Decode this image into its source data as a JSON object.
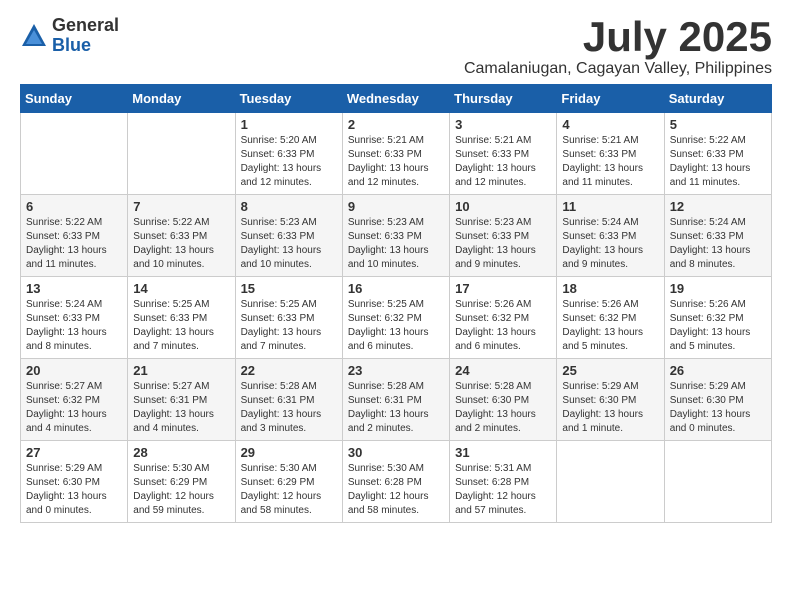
{
  "header": {
    "logo_general": "General",
    "logo_blue": "Blue",
    "month": "July 2025",
    "location": "Camalaniugan, Cagayan Valley, Philippines"
  },
  "weekdays": [
    "Sunday",
    "Monday",
    "Tuesday",
    "Wednesday",
    "Thursday",
    "Friday",
    "Saturday"
  ],
  "weeks": [
    [
      {
        "day": "",
        "detail": ""
      },
      {
        "day": "",
        "detail": ""
      },
      {
        "day": "1",
        "detail": "Sunrise: 5:20 AM\nSunset: 6:33 PM\nDaylight: 13 hours\nand 12 minutes."
      },
      {
        "day": "2",
        "detail": "Sunrise: 5:21 AM\nSunset: 6:33 PM\nDaylight: 13 hours\nand 12 minutes."
      },
      {
        "day": "3",
        "detail": "Sunrise: 5:21 AM\nSunset: 6:33 PM\nDaylight: 13 hours\nand 12 minutes."
      },
      {
        "day": "4",
        "detail": "Sunrise: 5:21 AM\nSunset: 6:33 PM\nDaylight: 13 hours\nand 11 minutes."
      },
      {
        "day": "5",
        "detail": "Sunrise: 5:22 AM\nSunset: 6:33 PM\nDaylight: 13 hours\nand 11 minutes."
      }
    ],
    [
      {
        "day": "6",
        "detail": "Sunrise: 5:22 AM\nSunset: 6:33 PM\nDaylight: 13 hours\nand 11 minutes."
      },
      {
        "day": "7",
        "detail": "Sunrise: 5:22 AM\nSunset: 6:33 PM\nDaylight: 13 hours\nand 10 minutes."
      },
      {
        "day": "8",
        "detail": "Sunrise: 5:23 AM\nSunset: 6:33 PM\nDaylight: 13 hours\nand 10 minutes."
      },
      {
        "day": "9",
        "detail": "Sunrise: 5:23 AM\nSunset: 6:33 PM\nDaylight: 13 hours\nand 10 minutes."
      },
      {
        "day": "10",
        "detail": "Sunrise: 5:23 AM\nSunset: 6:33 PM\nDaylight: 13 hours\nand 9 minutes."
      },
      {
        "day": "11",
        "detail": "Sunrise: 5:24 AM\nSunset: 6:33 PM\nDaylight: 13 hours\nand 9 minutes."
      },
      {
        "day": "12",
        "detail": "Sunrise: 5:24 AM\nSunset: 6:33 PM\nDaylight: 13 hours\nand 8 minutes."
      }
    ],
    [
      {
        "day": "13",
        "detail": "Sunrise: 5:24 AM\nSunset: 6:33 PM\nDaylight: 13 hours\nand 8 minutes."
      },
      {
        "day": "14",
        "detail": "Sunrise: 5:25 AM\nSunset: 6:33 PM\nDaylight: 13 hours\nand 7 minutes."
      },
      {
        "day": "15",
        "detail": "Sunrise: 5:25 AM\nSunset: 6:33 PM\nDaylight: 13 hours\nand 7 minutes."
      },
      {
        "day": "16",
        "detail": "Sunrise: 5:25 AM\nSunset: 6:32 PM\nDaylight: 13 hours\nand 6 minutes."
      },
      {
        "day": "17",
        "detail": "Sunrise: 5:26 AM\nSunset: 6:32 PM\nDaylight: 13 hours\nand 6 minutes."
      },
      {
        "day": "18",
        "detail": "Sunrise: 5:26 AM\nSunset: 6:32 PM\nDaylight: 13 hours\nand 5 minutes."
      },
      {
        "day": "19",
        "detail": "Sunrise: 5:26 AM\nSunset: 6:32 PM\nDaylight: 13 hours\nand 5 minutes."
      }
    ],
    [
      {
        "day": "20",
        "detail": "Sunrise: 5:27 AM\nSunset: 6:32 PM\nDaylight: 13 hours\nand 4 minutes."
      },
      {
        "day": "21",
        "detail": "Sunrise: 5:27 AM\nSunset: 6:31 PM\nDaylight: 13 hours\nand 4 minutes."
      },
      {
        "day": "22",
        "detail": "Sunrise: 5:28 AM\nSunset: 6:31 PM\nDaylight: 13 hours\nand 3 minutes."
      },
      {
        "day": "23",
        "detail": "Sunrise: 5:28 AM\nSunset: 6:31 PM\nDaylight: 13 hours\nand 2 minutes."
      },
      {
        "day": "24",
        "detail": "Sunrise: 5:28 AM\nSunset: 6:30 PM\nDaylight: 13 hours\nand 2 minutes."
      },
      {
        "day": "25",
        "detail": "Sunrise: 5:29 AM\nSunset: 6:30 PM\nDaylight: 13 hours\nand 1 minute."
      },
      {
        "day": "26",
        "detail": "Sunrise: 5:29 AM\nSunset: 6:30 PM\nDaylight: 13 hours\nand 0 minutes."
      }
    ],
    [
      {
        "day": "27",
        "detail": "Sunrise: 5:29 AM\nSunset: 6:30 PM\nDaylight: 13 hours\nand 0 minutes."
      },
      {
        "day": "28",
        "detail": "Sunrise: 5:30 AM\nSunset: 6:29 PM\nDaylight: 12 hours\nand 59 minutes."
      },
      {
        "day": "29",
        "detail": "Sunrise: 5:30 AM\nSunset: 6:29 PM\nDaylight: 12 hours\nand 58 minutes."
      },
      {
        "day": "30",
        "detail": "Sunrise: 5:30 AM\nSunset: 6:28 PM\nDaylight: 12 hours\nand 58 minutes."
      },
      {
        "day": "31",
        "detail": "Sunrise: 5:31 AM\nSunset: 6:28 PM\nDaylight: 12 hours\nand 57 minutes."
      },
      {
        "day": "",
        "detail": ""
      },
      {
        "day": "",
        "detail": ""
      }
    ]
  ]
}
